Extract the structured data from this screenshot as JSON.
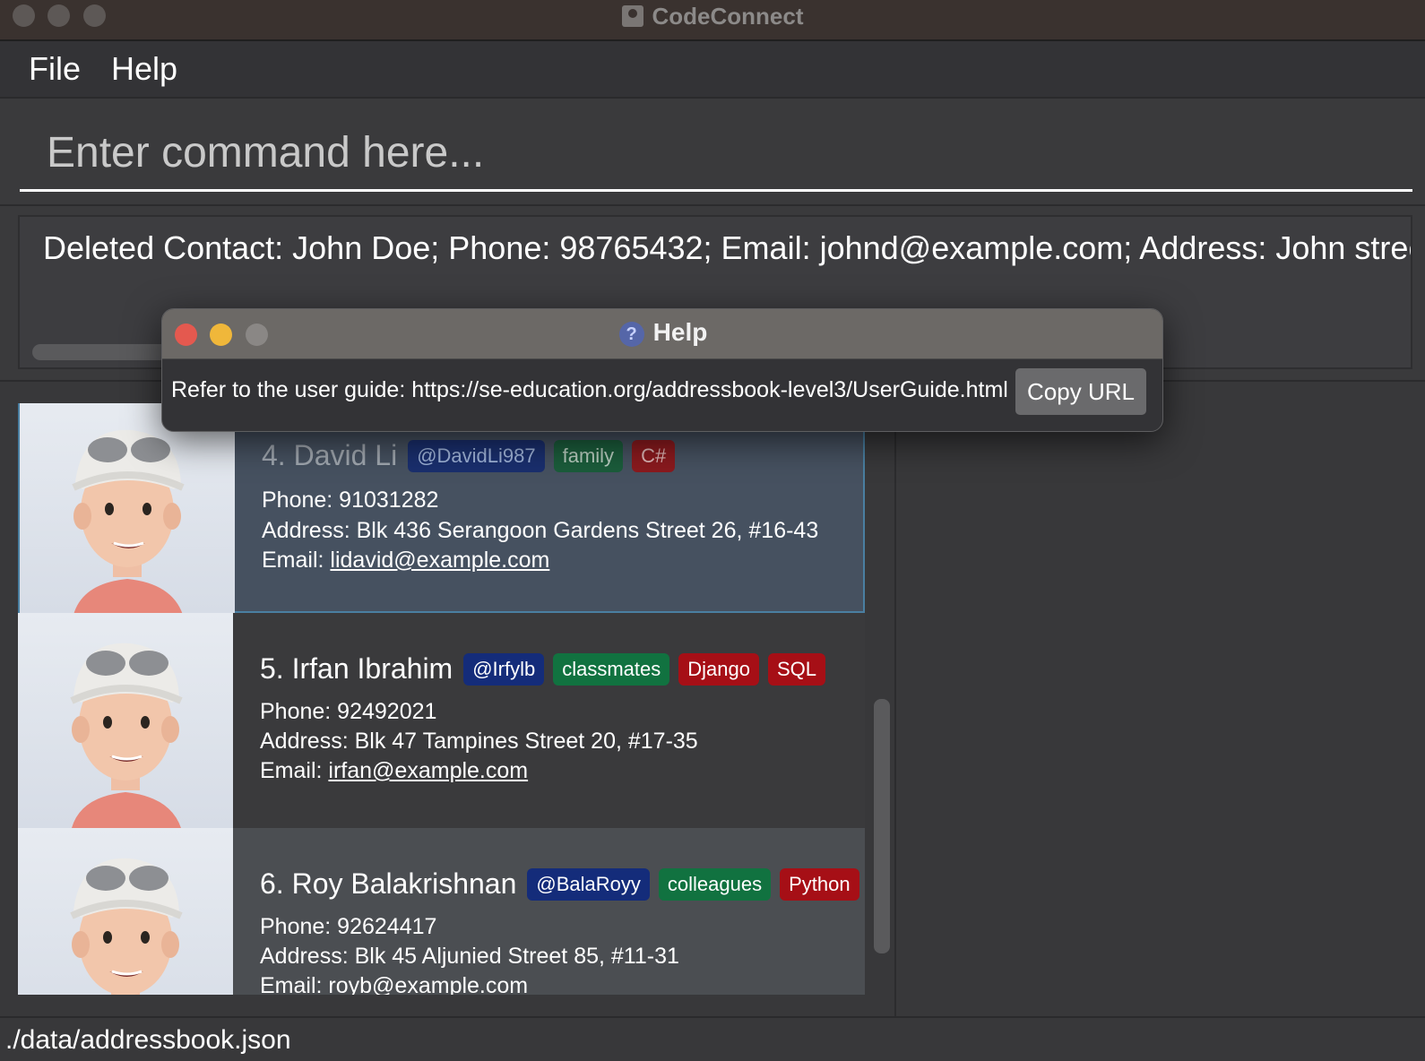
{
  "window": {
    "title": "CodeConnect"
  },
  "menu": {
    "items": [
      "File",
      "Help"
    ]
  },
  "command": {
    "placeholder": "Enter command here...",
    "value": ""
  },
  "result": {
    "text": "Deleted Contact: John Doe; Phone: 98765432; Email: johnd@example.com; Address: John street,"
  },
  "contacts": [
    {
      "index": "4.",
      "name": "David Li",
      "handle": "@DavidLi987",
      "group": "family",
      "skills": [
        "C#"
      ],
      "phone": "Phone: 91031282",
      "address": "Address: Blk 436 Serangoon Gardens Street 26, #16-43",
      "email_label": "Email:",
      "email": "lidavid@example.com",
      "selected": true
    },
    {
      "index": "5.",
      "name": "Irfan Ibrahim",
      "handle": "@Irfylb",
      "group": "classmates",
      "skills": [
        "Django",
        "SQL"
      ],
      "phone": "Phone: 92492021",
      "address": "Address: Blk 47 Tampines Street 20, #17-35",
      "email_label": "Email:",
      "email": "irfan@example.com",
      "selected": false
    },
    {
      "index": "6.",
      "name": "Roy Balakrishnan",
      "handle": "@BalaRoyy",
      "group": "colleagues",
      "skills": [
        "Python"
      ],
      "phone": "Phone: 92624417",
      "address": "Address: Blk 45 Aljunied Street 85, #11-31",
      "email_label": "Email:",
      "email": "royb@example.com",
      "selected": false
    }
  ],
  "status": {
    "path": "./data/addressbook.json"
  },
  "help_dialog": {
    "title": "Help",
    "message": "Refer to the user guide: https://se-education.org/addressbook-level3/UserGuide.html",
    "copy_button": "Copy URL"
  },
  "colors": {
    "handle_tag": "#142c7a",
    "group_tag": "#117240",
    "skill_tag": "#a60f16",
    "close_dot": "#e4594f",
    "minimize_dot": "#f0b73a",
    "zoom_dot_inactive": "#8a8785"
  }
}
